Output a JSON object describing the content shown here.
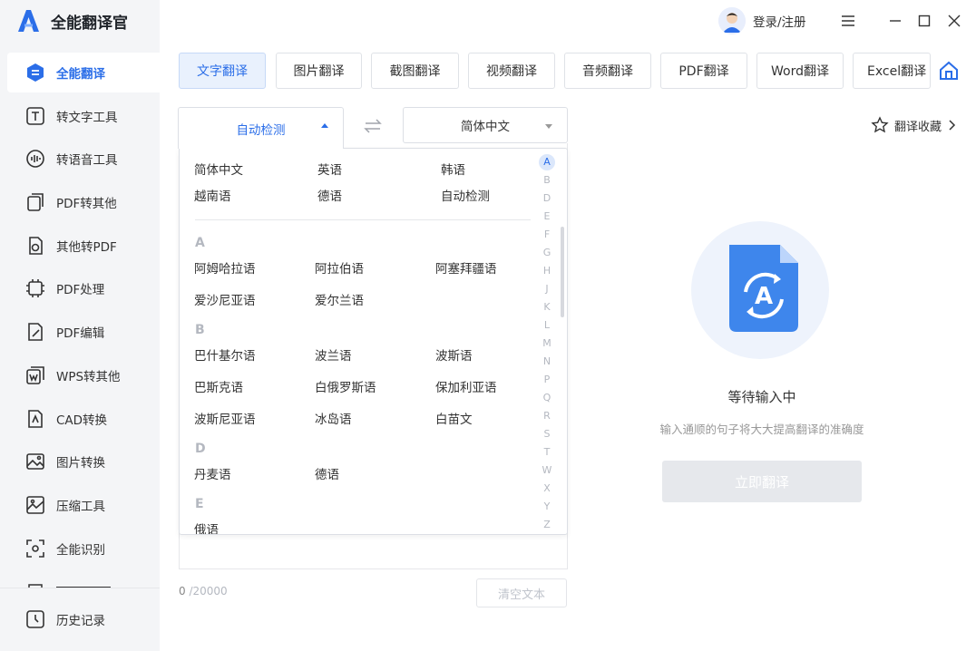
{
  "app": {
    "name": "全能翻译官"
  },
  "colors": {
    "accent": "#2b6ee8",
    "sidebar_bg": "#f4f5f7",
    "active_tab_bg": "#e9f1fd"
  },
  "header": {
    "login_label": "登录/注册"
  },
  "sidebar": {
    "items": [
      {
        "label": "全能翻译",
        "icon": "translate-icon",
        "active": true
      },
      {
        "label": "转文字工具",
        "icon": "text-tool-icon"
      },
      {
        "label": "转语音工具",
        "icon": "voice-icon"
      },
      {
        "label": "PDF转其他",
        "icon": "pdf-export-icon"
      },
      {
        "label": "其他转PDF",
        "icon": "pdf-import-icon"
      },
      {
        "label": "PDF处理",
        "icon": "pdf-process-icon"
      },
      {
        "label": "PDF编辑",
        "icon": "pdf-edit-icon"
      },
      {
        "label": "WPS转其他",
        "icon": "wps-icon"
      },
      {
        "label": "CAD转换",
        "icon": "cad-icon"
      },
      {
        "label": "图片转换",
        "icon": "image-icon"
      },
      {
        "label": "压缩工具",
        "icon": "compress-icon"
      },
      {
        "label": "全能识别",
        "icon": "recognize-icon"
      }
    ],
    "history_label": "历史记录"
  },
  "tabs": [
    "文字翻译",
    "图片翻译",
    "截图翻译",
    "视频翻译",
    "音频翻译",
    "PDF翻译",
    "Word翻译",
    "Excel翻译"
  ],
  "source_lang": "自动检测",
  "target_lang": "简体中文",
  "favorites_label": "翻译收藏",
  "dropdown": {
    "common": [
      "简体中文",
      "英语",
      "韩语",
      "越南语",
      "德语",
      "自动检测"
    ],
    "groups": [
      {
        "letter": "A",
        "langs": [
          "阿姆哈拉语",
          "阿拉伯语",
          "阿塞拜疆语",
          "爱沙尼亚语",
          "爱尔兰语"
        ]
      },
      {
        "letter": "B",
        "langs": [
          "巴什基尔语",
          "波兰语",
          "波斯语",
          "巴斯克语",
          "白俄罗斯语",
          "保加利亚语",
          "波斯尼亚语",
          "冰岛语",
          "白苗文"
        ]
      },
      {
        "letter": "D",
        "langs": [
          "丹麦语",
          "德语"
        ]
      },
      {
        "letter": "E",
        "langs": [
          "俄语"
        ]
      }
    ],
    "index": [
      "A",
      "B",
      "D",
      "E",
      "F",
      "G",
      "H",
      "J",
      "K",
      "L",
      "M",
      "N",
      "P",
      "Q",
      "R",
      "S",
      "T",
      "W",
      "X",
      "Y",
      "Z"
    ]
  },
  "input": {
    "count": "0",
    "limit": "/20000",
    "clear_label": "清空文本"
  },
  "output": {
    "status": "等待输入中",
    "hint": "输入通顺的句子将大大提高翻译的准确度",
    "translate_label": "立即翻译"
  }
}
